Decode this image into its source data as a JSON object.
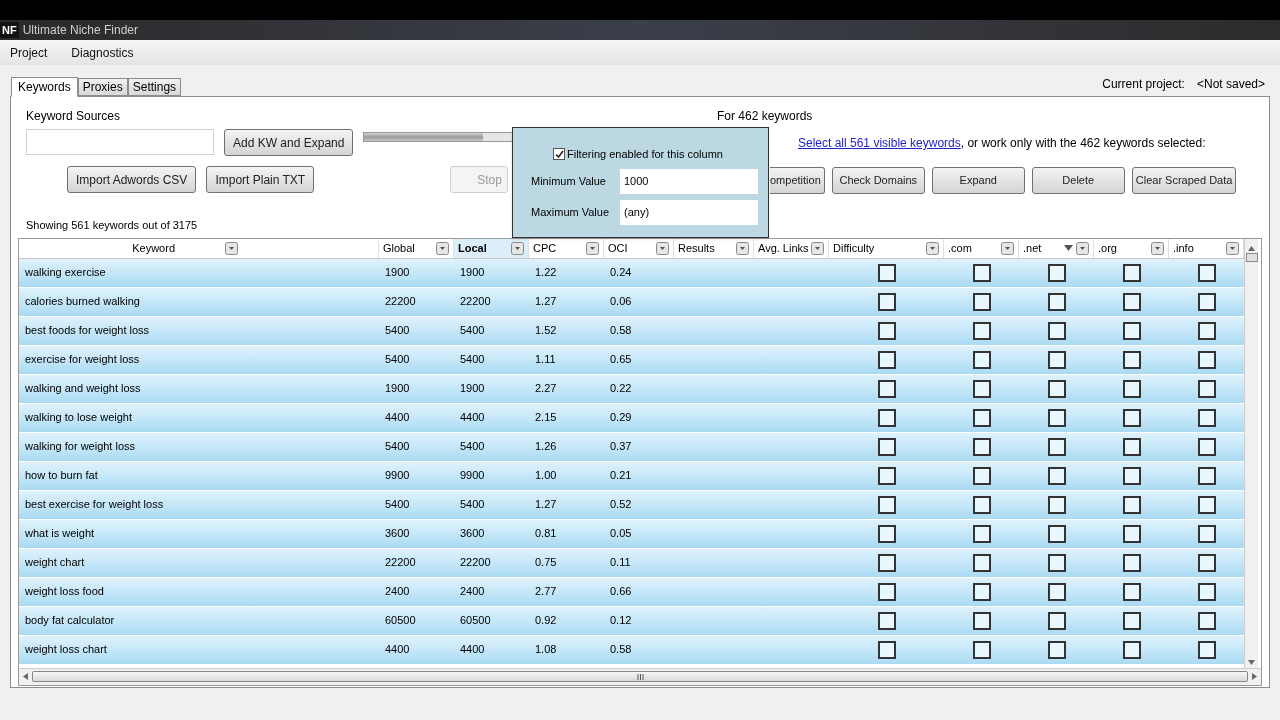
{
  "window": {
    "title": "Ultimate Niche Finder",
    "icon_text": "NF"
  },
  "menu": [
    "Project",
    "Diagnostics"
  ],
  "tabs": [
    {
      "label": "Keywords",
      "selected": true
    },
    {
      "label": "Proxies",
      "selected": false
    },
    {
      "label": "Settings",
      "selected": false
    }
  ],
  "current_project": {
    "label": "Current project:",
    "value": "<Not saved>"
  },
  "sources": {
    "label": "Keyword Sources",
    "progress": {
      "level": 0.6
    },
    "add_button": "Add KW and Expand",
    "import_buttons": [
      "Import Adwords CSV",
      "Import Plain TXT"
    ],
    "stop_button": "Stop"
  },
  "selection": {
    "label": "For 462 keywords",
    "link": "Select all 561 visible keywords",
    "text": ", or work only with the 462 keywords selected:",
    "buttons": [
      "ompetition",
      "Check Domains",
      "Expand",
      "Delete",
      "Clear Scraped Data"
    ]
  },
  "filter_popup": {
    "checkbox_label": "Filtering enabled for this column",
    "checked": true,
    "min_label": "Minimum Value",
    "min_value": "1000",
    "max_label": "Maximum Value",
    "max_value": "(any)"
  },
  "summary": "Showing 561 keywords out of 3175",
  "table": {
    "columns": [
      {
        "label": "Keyword",
        "selected": false,
        "sorted": false
      },
      {
        "label": "Global",
        "selected": false,
        "sorted": false
      },
      {
        "label": "Local",
        "selected": true,
        "sorted": false
      },
      {
        "label": "CPC",
        "selected": false,
        "sorted": false
      },
      {
        "label": "OCI",
        "selected": false,
        "sorted": false
      },
      {
        "label": "Results",
        "selected": false,
        "sorted": false
      },
      {
        "label": "Avg. Links",
        "selected": false,
        "sorted": false
      },
      {
        "label": "Difficulty",
        "selected": false,
        "sorted": false
      },
      {
        "label": ".com",
        "selected": false,
        "sorted": false
      },
      {
        "label": ".net",
        "selected": false,
        "sorted": true
      },
      {
        "label": ".org",
        "selected": false,
        "sorted": false
      },
      {
        "label": ".info",
        "selected": false,
        "sorted": false
      }
    ],
    "rows": [
      {
        "cells": [
          "walking exercise",
          "1900",
          "1900",
          "1.22",
          "0.24"
        ],
        "checks": [
          false,
          false,
          false,
          false,
          false
        ]
      },
      {
        "cells": [
          "calories burned walking",
          "22200",
          "22200",
          "1.27",
          "0.06"
        ],
        "checks": [
          false,
          false,
          false,
          false,
          false
        ]
      },
      {
        "cells": [
          "best foods for weight loss",
          "5400",
          "5400",
          "1.52",
          "0.58"
        ],
        "checks": [
          false,
          false,
          false,
          false,
          false
        ]
      },
      {
        "cells": [
          "exercise for weight loss",
          "5400",
          "5400",
          "1.11",
          "0.65"
        ],
        "checks": [
          false,
          false,
          false,
          false,
          false
        ]
      },
      {
        "cells": [
          "walking and weight loss",
          "1900",
          "1900",
          "2.27",
          "0.22"
        ],
        "checks": [
          false,
          false,
          false,
          false,
          false
        ]
      },
      {
        "cells": [
          "walking to lose weight",
          "4400",
          "4400",
          "2.15",
          "0.29"
        ],
        "checks": [
          false,
          false,
          false,
          false,
          false
        ]
      },
      {
        "cells": [
          "walking for weight loss",
          "5400",
          "5400",
          "1.26",
          "0.37"
        ],
        "checks": [
          false,
          false,
          false,
          false,
          false
        ]
      },
      {
        "cells": [
          "how to burn fat",
          "9900",
          "9900",
          "1.00",
          "0.21"
        ],
        "checks": [
          false,
          false,
          false,
          false,
          false
        ]
      },
      {
        "cells": [
          "best exercise for weight loss",
          "5400",
          "5400",
          "1.27",
          "0.52"
        ],
        "checks": [
          false,
          false,
          false,
          false,
          false
        ]
      },
      {
        "cells": [
          "what is weight",
          "3600",
          "3600",
          "0.81",
          "0.05"
        ],
        "checks": [
          false,
          false,
          false,
          false,
          false
        ]
      },
      {
        "cells": [
          "weight chart",
          "22200",
          "22200",
          "0.75",
          "0.11"
        ],
        "checks": [
          false,
          false,
          false,
          false,
          false
        ]
      },
      {
        "cells": [
          "weight loss food",
          "2400",
          "2400",
          "2.77",
          "0.66"
        ],
        "checks": [
          false,
          false,
          false,
          false,
          false
        ]
      },
      {
        "cells": [
          "body fat calculator",
          "60500",
          "60500",
          "0.92",
          "0.12"
        ],
        "checks": [
          false,
          false,
          false,
          false,
          false
        ]
      },
      {
        "cells": [
          "weight loss chart",
          "4400",
          "4400",
          "1.08",
          "0.58"
        ],
        "checks": [
          false,
          false,
          false,
          false,
          false
        ]
      }
    ]
  }
}
